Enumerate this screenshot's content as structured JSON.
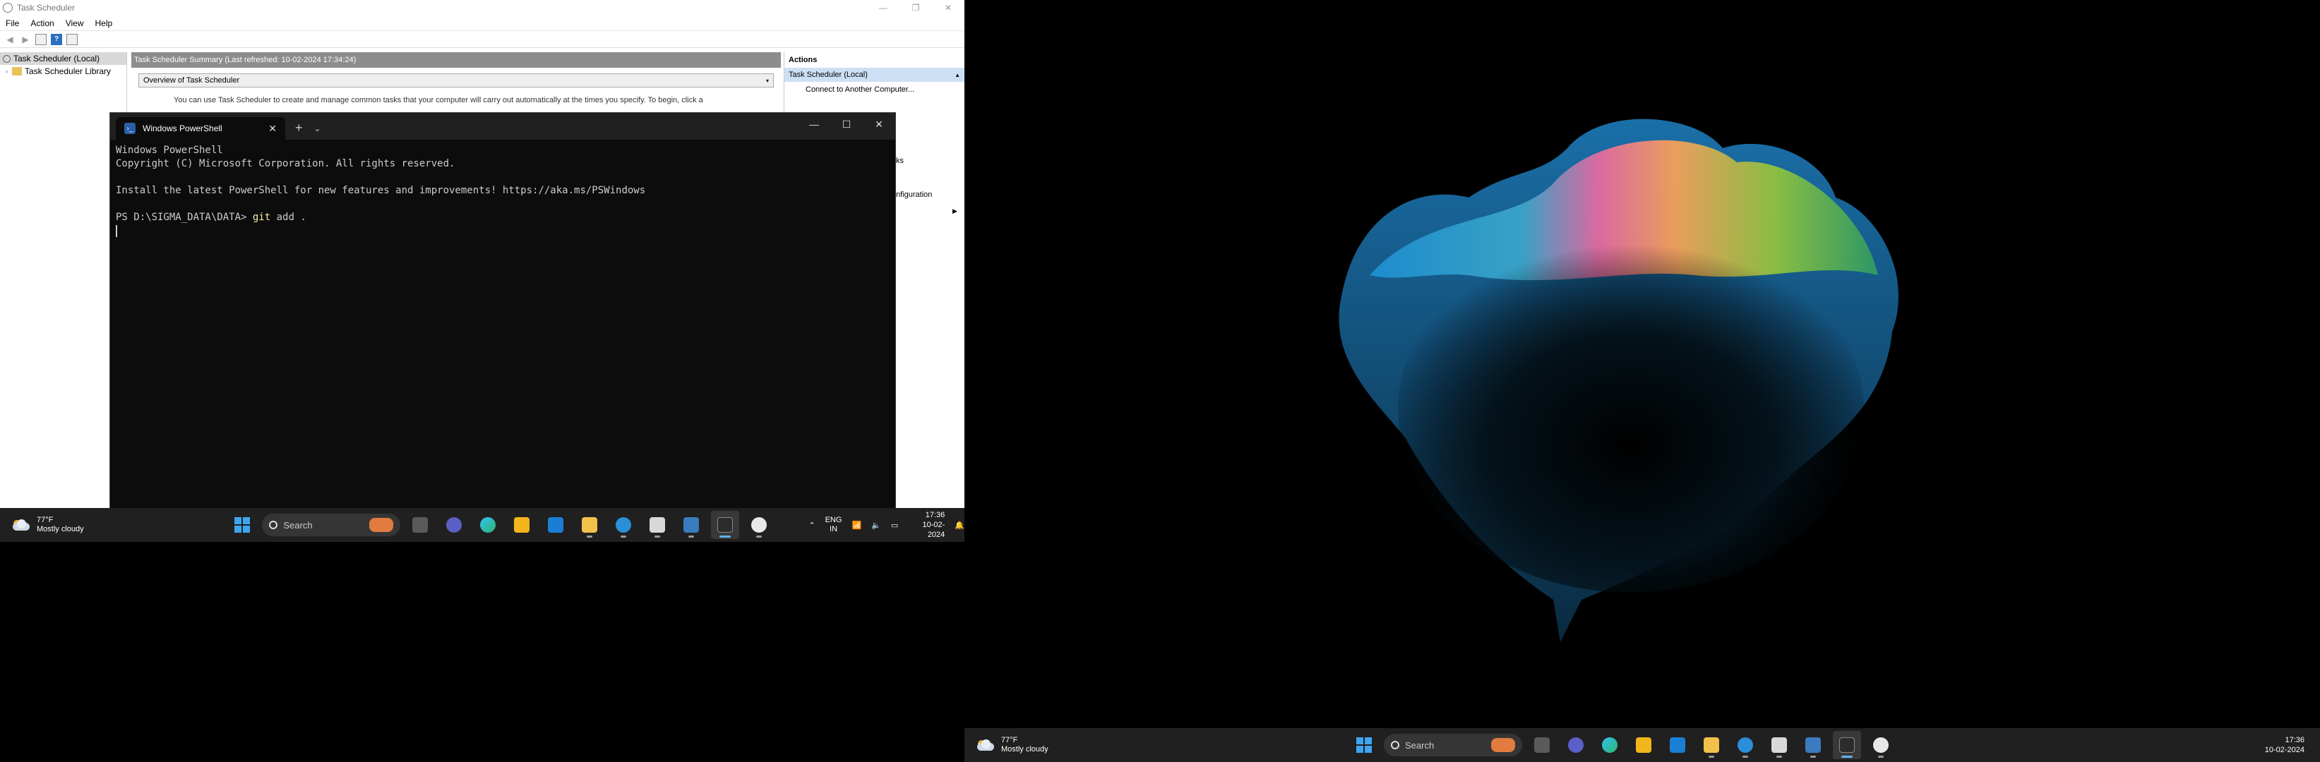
{
  "task_scheduler": {
    "title": "Task Scheduler",
    "menu": [
      "File",
      "Action",
      "View",
      "Help"
    ],
    "tree": [
      "Task Scheduler (Local)",
      "Task Scheduler Library"
    ],
    "summary": "Task Scheduler Summary (Last refreshed: 10-02-2024 17:34:24)",
    "overview": "Overview of Task Scheduler",
    "overview_text": "You can use Task Scheduler to create and manage common tasks that your computer will carry out automatically at the times you specify. To begin, click a",
    "actions_header": "Actions",
    "actions_selected": "Task Scheduler (Local)",
    "actions_items": [
      "Connect to Another Computer..."
    ],
    "actions_fragments": [
      "ks",
      "nfiguration"
    ]
  },
  "powershell": {
    "tab_title": "Windows PowerShell",
    "lines": [
      "Windows PowerShell",
      "Copyright (C) Microsoft Corporation. All rights reserved.",
      "",
      "Install the latest PowerShell for new features and improvements! https://aka.ms/PSWindows",
      ""
    ],
    "prompt": "PS D:\\SIGMA_DATA\\DATA> ",
    "command_keyword": "git",
    "command_rest": " add ."
  },
  "taskbar": {
    "weather_temp": "77°F",
    "weather_desc": "Mostly cloudy",
    "search_placeholder": "Search",
    "lang1": "ENG",
    "lang2": "IN",
    "time": "17:36",
    "date": "10-02-2024"
  },
  "colors": {
    "taskbar_bg": "#202020",
    "terminal_bg": "#0c0c0c",
    "accent": "#5fb2f2",
    "command": "#f9f1a5"
  }
}
